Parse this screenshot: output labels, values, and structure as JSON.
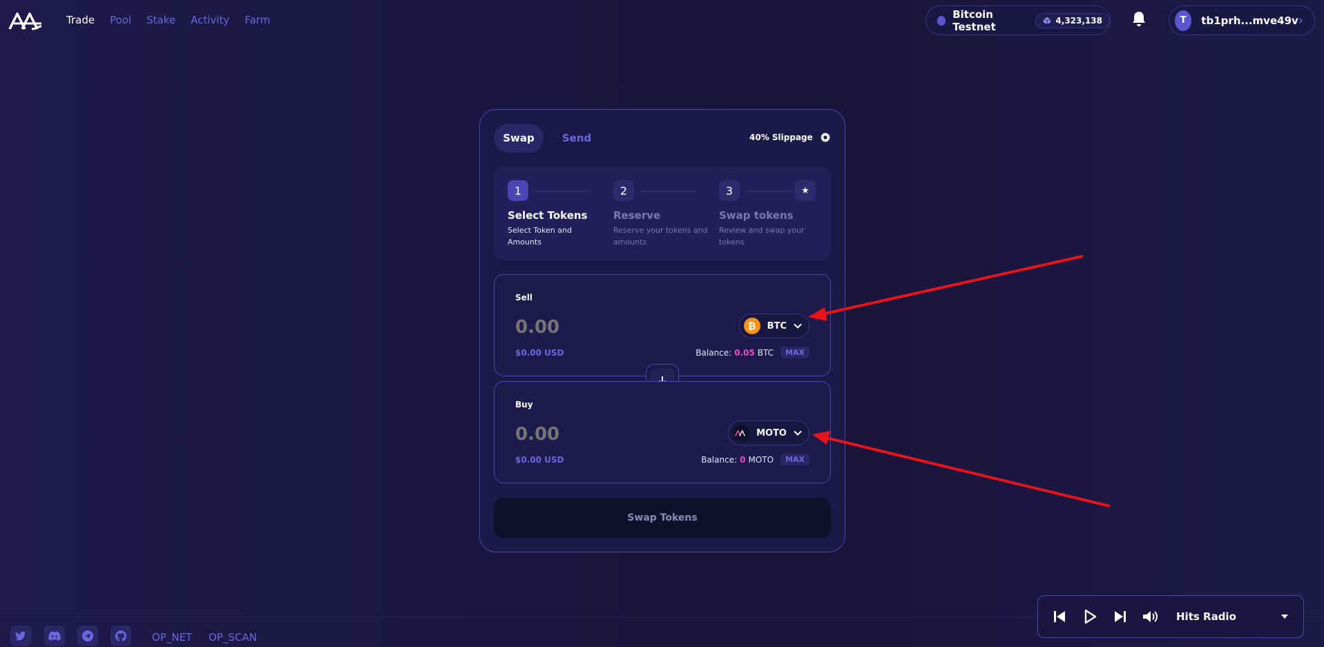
{
  "nav": {
    "items": [
      "Trade",
      "Pool",
      "Stake",
      "Activity",
      "Farm"
    ],
    "active": "Trade"
  },
  "network": {
    "name": "Bitcoin Testnet",
    "block_height": "4,323,138"
  },
  "wallet": {
    "avatar_letter": "T",
    "address": "tb1prh...mve49v"
  },
  "tabs": {
    "swap": "Swap",
    "send": "Send"
  },
  "slippage": "40% Slippage",
  "steps": [
    {
      "num": "1",
      "title": "Select Tokens",
      "desc": "Select Token and Amounts"
    },
    {
      "num": "2",
      "title": "Reserve",
      "desc": "Reserve your tokens and amounts"
    },
    {
      "num": "3",
      "title": "Swap tokens",
      "desc": "Review and swap your tokens"
    }
  ],
  "sell": {
    "label": "Sell",
    "amount_placeholder": "0.00",
    "usd": "$0.00 USD",
    "token": "BTC",
    "balance_label": "Balance:",
    "balance_value": "0.05",
    "balance_unit": "BTC",
    "max": "MAX"
  },
  "buy": {
    "label": "Buy",
    "amount_placeholder": "0.00",
    "usd": "$0.00 USD",
    "token": "MOTO",
    "balance_label": "Balance:",
    "balance_value": "0",
    "balance_unit": "MOTO",
    "max": "MAX"
  },
  "submit_label": "Swap Tokens",
  "footer": {
    "links": [
      "OP_NET",
      "OP_SCAN"
    ]
  },
  "player": {
    "station": "Hits Radio"
  },
  "colors": {
    "accent": "#6b67e0",
    "balance_highlight": "#e64cc8",
    "annotation_arrow": "#e8131b",
    "btc_orange": "#f7931a"
  }
}
